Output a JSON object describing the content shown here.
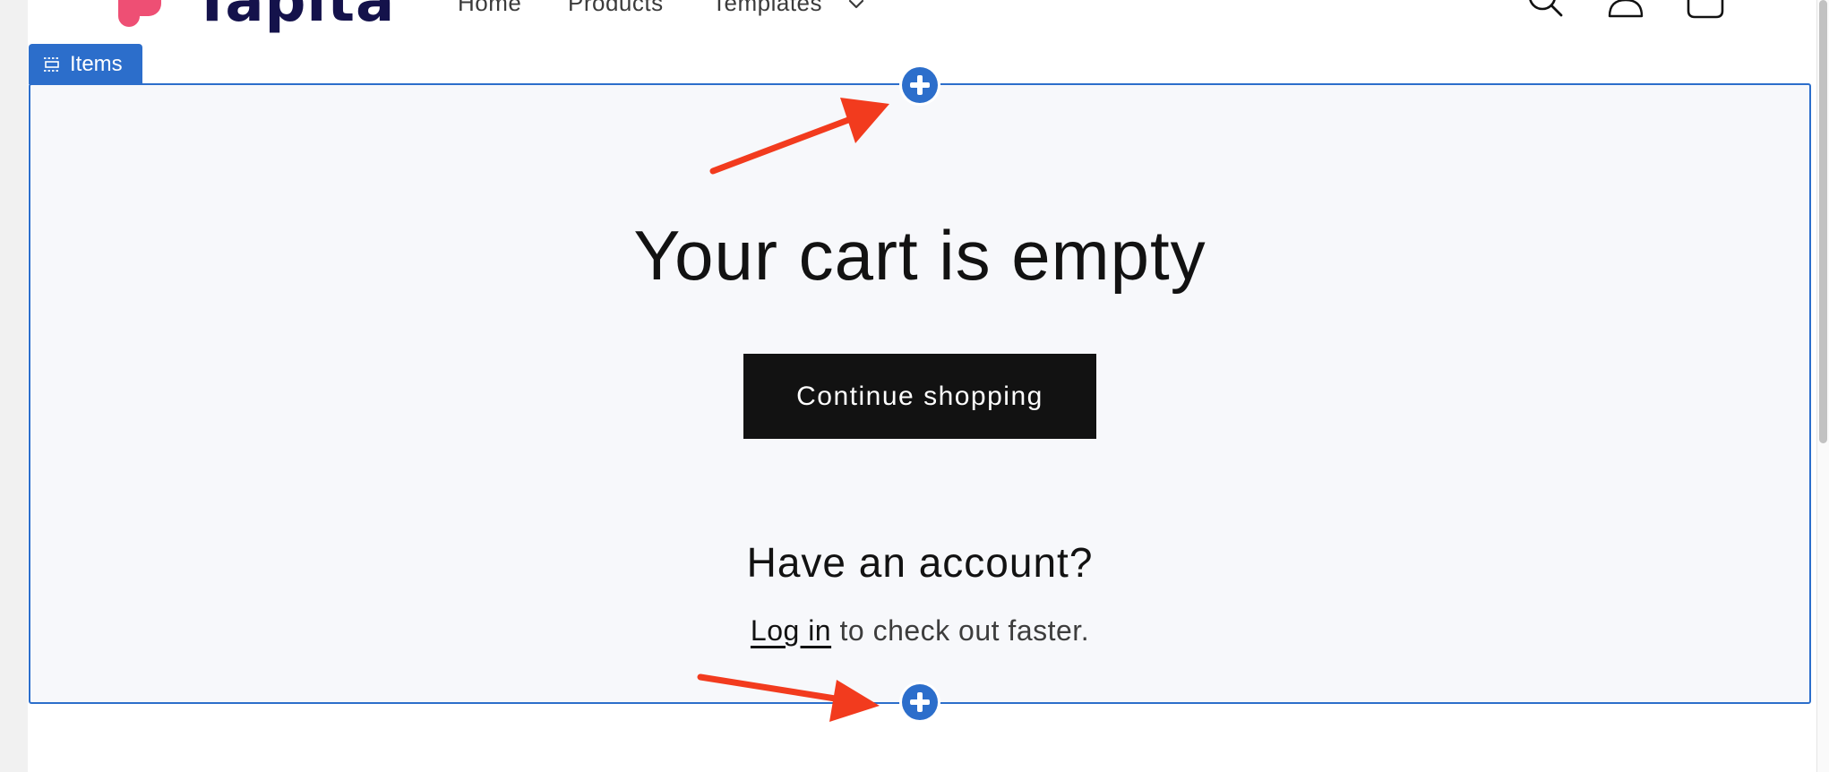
{
  "header": {
    "logo_text": "Tapita",
    "nav": {
      "home": "Home",
      "products": "Products",
      "templates": "Templates"
    }
  },
  "section": {
    "tab_label": "Items"
  },
  "cart": {
    "title": "Your cart is empty",
    "continue_label": "Continue shopping",
    "account_heading": "Have an account?",
    "login_link": "Log in",
    "login_suffix": " to check out faster."
  },
  "colors": {
    "accent": "#2c6ecb",
    "button_dark": "#121212",
    "section_bg": "#f7f8fb",
    "annotation_arrow": "#f23b1e",
    "logo_pink": "#ee4f74",
    "logo_navy": "#14124b"
  },
  "icons": {
    "header": [
      "search-icon",
      "account-icon",
      "cart-icon"
    ],
    "section_tab": "section-icon",
    "add": "plus-circle-icon",
    "annotation": "red-arrow"
  }
}
